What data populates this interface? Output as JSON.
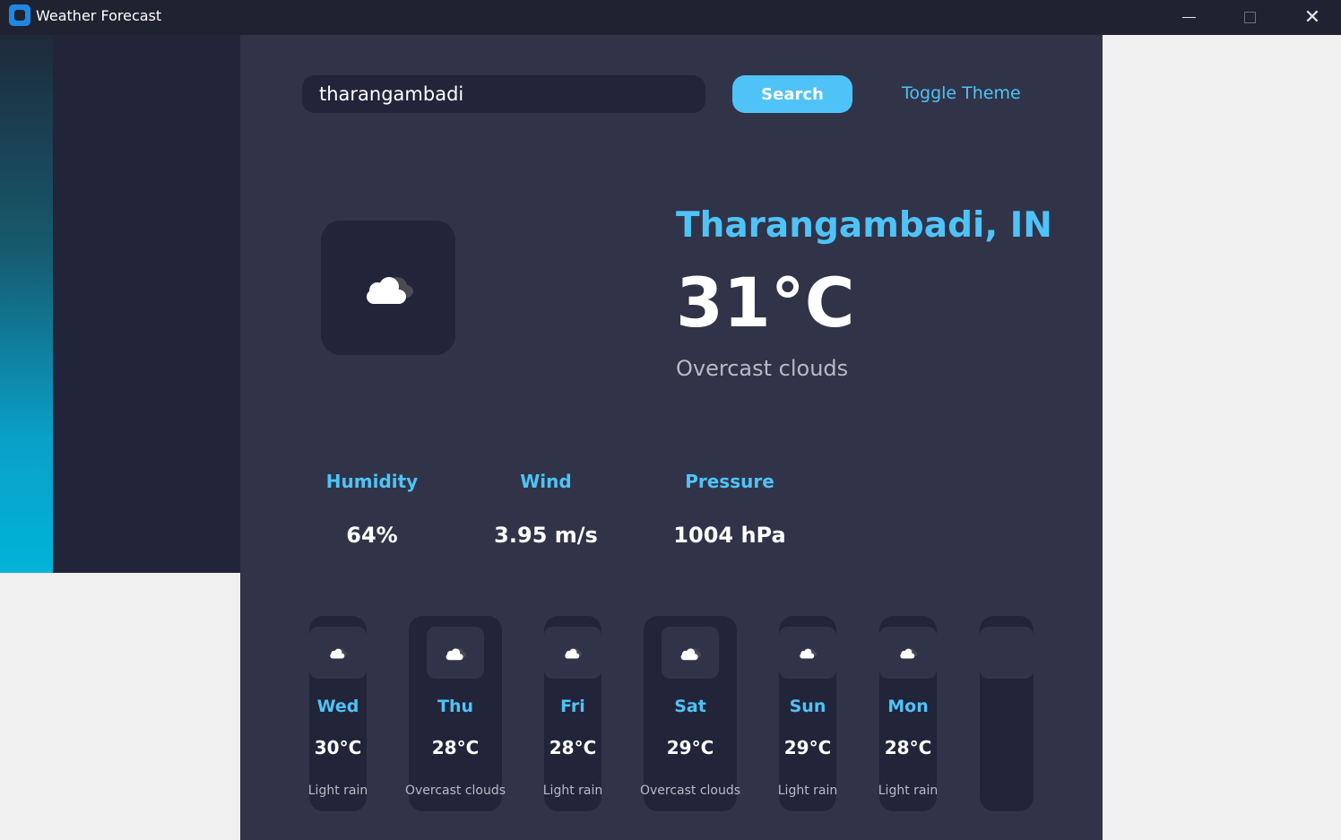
{
  "window": {
    "title": "Weather Forecast"
  },
  "search": {
    "value": "tharangambadi",
    "button_label": "Search"
  },
  "toggle_theme_label": "Toggle Theme",
  "current": {
    "location": "Tharangambadi, IN",
    "temperature": "31°C",
    "description": "Overcast clouds",
    "icon": "cloud-icon"
  },
  "stats": [
    {
      "label": "Humidity",
      "value": "64%"
    },
    {
      "label": "Wind",
      "value": "3.95 m/s"
    },
    {
      "label": "Pressure",
      "value": "1004 hPa"
    }
  ],
  "forecast": [
    {
      "day": "Wed",
      "temp": "30°C",
      "desc": "Light rain",
      "icon": "cloud-icon"
    },
    {
      "day": "Thu",
      "temp": "28°C",
      "desc": "Overcast clouds",
      "icon": "cloud-icon"
    },
    {
      "day": "Fri",
      "temp": "28°C",
      "desc": "Light rain",
      "icon": "cloud-icon"
    },
    {
      "day": "Sat",
      "temp": "29°C",
      "desc": "Overcast clouds",
      "icon": "cloud-icon"
    },
    {
      "day": "Sun",
      "temp": "29°C",
      "desc": "Light rain",
      "icon": "cloud-icon"
    },
    {
      "day": "Mon",
      "temp": "28°C",
      "desc": "Light rain",
      "icon": "cloud-icon"
    },
    {
      "day": "",
      "temp": "",
      "desc": "",
      "icon": ""
    }
  ],
  "colors": {
    "accent": "#4fc3f7",
    "panel": "#313448",
    "card": "#22243a",
    "titlebar": "#1f2230"
  }
}
